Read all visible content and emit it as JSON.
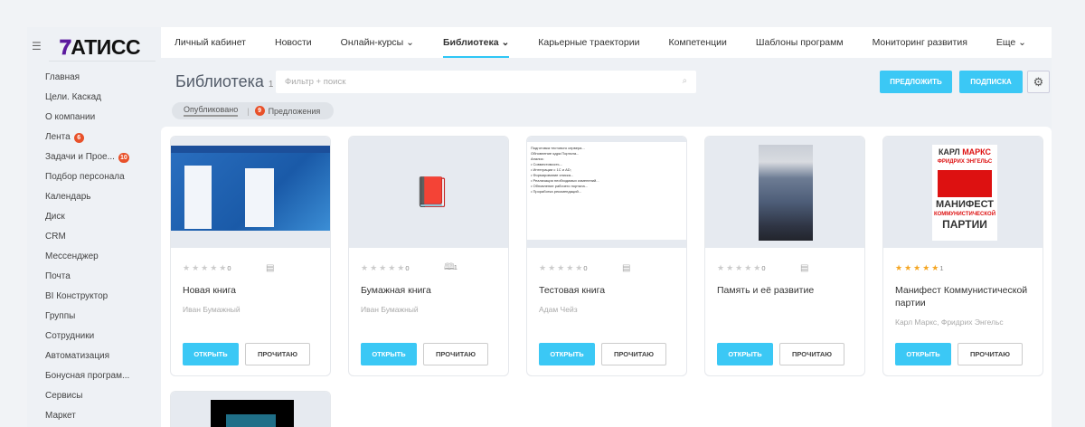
{
  "logo": "АТИСС",
  "sidebar": {
    "items": [
      {
        "label": "Главная"
      },
      {
        "label": "Цели. Каскад"
      },
      {
        "label": "О компании"
      },
      {
        "label": "Лента",
        "badge": "6"
      },
      {
        "label": "Задачи и Прое...",
        "badge": "10"
      },
      {
        "label": "Подбор персонала"
      },
      {
        "label": "Календарь"
      },
      {
        "label": "Диск"
      },
      {
        "label": "CRM"
      },
      {
        "label": "Мессенджер"
      },
      {
        "label": "Почта"
      },
      {
        "label": "BI Конструктор"
      },
      {
        "label": "Группы"
      },
      {
        "label": "Сотрудники"
      },
      {
        "label": "Автоматизация"
      },
      {
        "label": "Бонусная програм..."
      },
      {
        "label": "Сервисы"
      },
      {
        "label": "Маркет"
      }
    ]
  },
  "nav": [
    {
      "label": "Личный кабинет"
    },
    {
      "label": "Новости"
    },
    {
      "label": "Онлайн-курсы ⌄"
    },
    {
      "label": "Библиотека ⌄"
    },
    {
      "label": "Карьерные траектории"
    },
    {
      "label": "Компетенции"
    },
    {
      "label": "Шаблоны программ"
    },
    {
      "label": "Мониторинг развития"
    },
    {
      "label": "Еще ⌄"
    }
  ],
  "header": {
    "title": "Библиотека",
    "count": "1",
    "search_placeholder": "Фильтр + поиск",
    "suggest": "ПРЕДЛОЖИТЬ",
    "subscribe": "ПОДПИСКА"
  },
  "filters": {
    "published": "Опубликовано",
    "offers_badge": "9",
    "offers": "Предложения"
  },
  "cards": [
    {
      "title": "Новая книга",
      "author": "Иван Бумажный",
      "rating": 0,
      "count": "0",
      "format": "ebook",
      "open": "ОТКРЫТЬ",
      "read": "ПРОЧИТАЮ"
    },
    {
      "title": "Бумажная книга",
      "author": "Иван Бумажный",
      "rating": 0,
      "count": "0",
      "format": "paper",
      "paper_count": "1",
      "open": "ОТКРЫТЬ",
      "read": "ПРОЧИТАЮ"
    },
    {
      "title": "Тестовая книга",
      "author": "Адам Чейз",
      "rating": 0,
      "count": "0",
      "format": "ebook",
      "open": "ОТКРЫТЬ",
      "read": "ПРОЧИТАЮ"
    },
    {
      "title": "Память и её развитие",
      "author": "",
      "rating": 0,
      "count": "0",
      "format": "ebook",
      "open": "ОТКРЫТЬ",
      "read": "ПРОЧИТАЮ"
    },
    {
      "title": "Манифест Коммунистической партии",
      "author": "Карл Маркс, Фридрих Энгельс",
      "rating": 5,
      "count": "1",
      "format": "",
      "open": "ОТКРЫТЬ",
      "read": "ПРОЧИТАЮ",
      "cover_text": [
        "КАРЛ МАРКС",
        "ФРИДРИХ ЭНГЕЛЬС",
        "МАНИФЕСТ",
        "КОММУНИСТИЧЕСКОЙ",
        "ПАРТИИ"
      ]
    }
  ]
}
